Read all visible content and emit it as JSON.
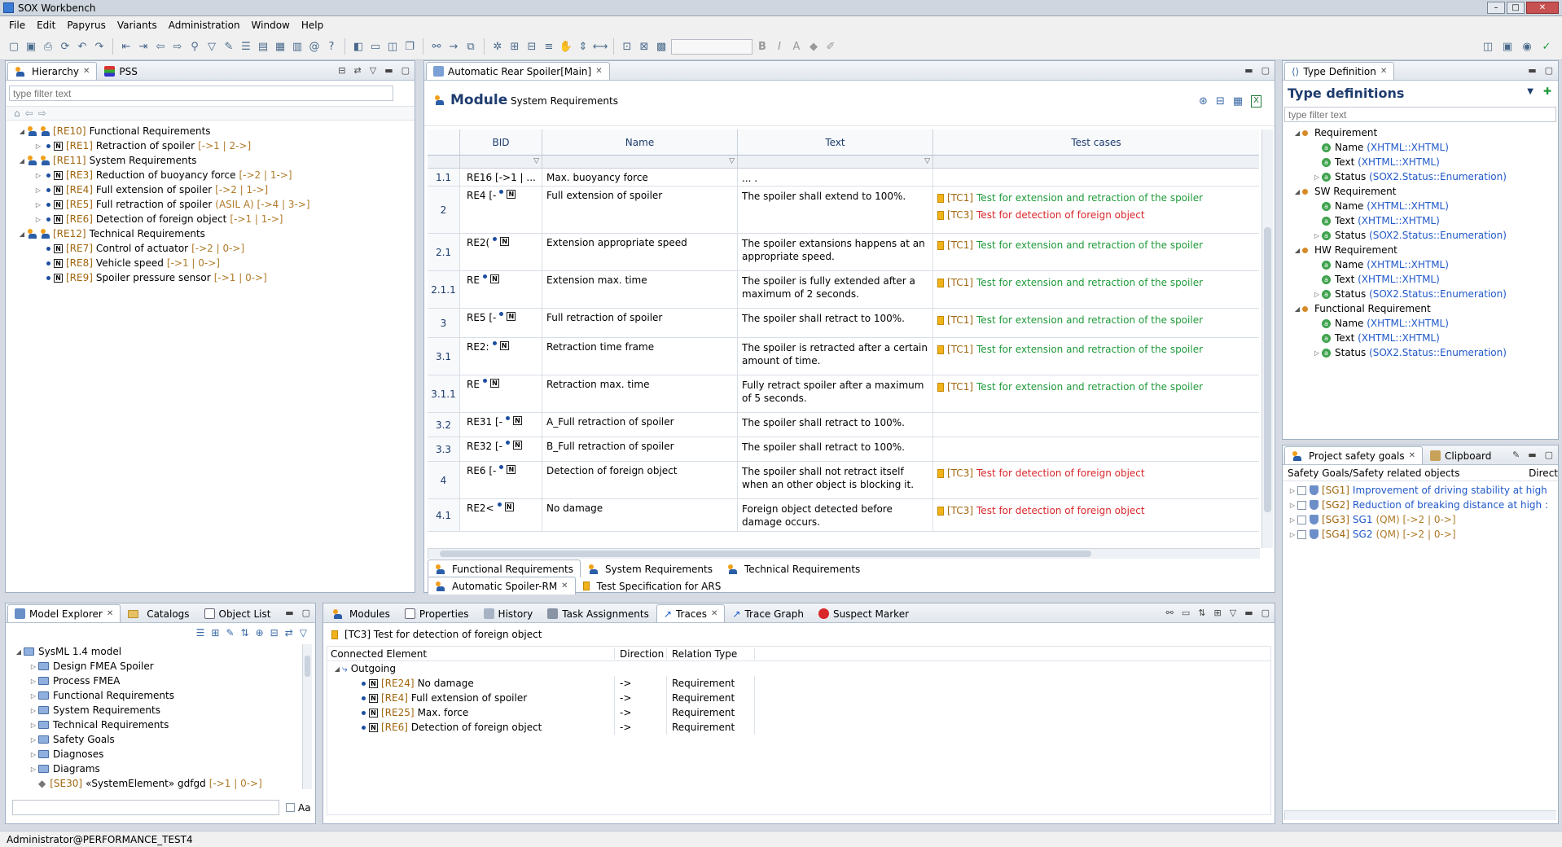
{
  "window": {
    "title": "SOX Workbench"
  },
  "menu": [
    "File",
    "Edit",
    "Papyrus",
    "Variants",
    "Administration",
    "Window",
    "Help"
  ],
  "hierarchy": {
    "tabs": [
      "Hierarchy",
      "PSS"
    ],
    "filter_placeholder": "type filter text",
    "rows": [
      {
        "level": 0,
        "id": "[RE10]",
        "label": "Functional Requirements",
        "meta": ""
      },
      {
        "level": 1,
        "id": "[RE1]",
        "label": "Retraction of spoiler",
        "meta": "[->1 | 2->]"
      },
      {
        "level": 0,
        "id": "[RE11]",
        "label": "System Requirements",
        "meta": ""
      },
      {
        "level": 1,
        "id": "[RE3]",
        "label": "Reduction of buoyancy force",
        "meta": "[->2 | 1->]"
      },
      {
        "level": 1,
        "id": "[RE4]",
        "label": "Full extension of spoiler",
        "meta": "[->2 | 1->]"
      },
      {
        "level": 1,
        "id": "[RE5]",
        "label": "Full retraction of spoiler",
        "meta": "(ASIL A) [->4 | 3->]"
      },
      {
        "level": 1,
        "id": "[RE6]",
        "label": "Detection of foreign object",
        "meta": "[->1 | 1->]"
      },
      {
        "level": 0,
        "id": "[RE12]",
        "label": "Technical Requirements",
        "meta": ""
      },
      {
        "level": 1,
        "id": "[RE7]",
        "label": "Control of actuator",
        "meta": "[->2 | 0->]"
      },
      {
        "level": 1,
        "id": "[RE8]",
        "label": "Vehicle speed",
        "meta": "[->1 | 0->]"
      },
      {
        "level": 1,
        "id": "[RE9]",
        "label": "Spoiler pressure sensor",
        "meta": "[->1 | 0->]"
      }
    ]
  },
  "editor": {
    "tab": "Automatic Rear Spoiler[Main]",
    "module_label": "Module",
    "module_name": "System Requirements",
    "columns": [
      "BID",
      "Name",
      "Text",
      "Test cases"
    ],
    "rows": [
      {
        "num": "1.1",
        "bid": "RE16 [->1 | ...",
        "name": "Max. buoyancy force",
        "text": "... .",
        "tcs": []
      },
      {
        "num": "2",
        "bid": "RE4 [-",
        "name": "Full extension of spoiler",
        "text": "The spoiler shall extend to 100%.",
        "tcs": [
          {
            "id": "[TC1]",
            "label": "Test for extension and retraction of the spoiler",
            "color": "green"
          },
          {
            "id": "[TC3]",
            "label": "Test for detection of foreign object",
            "color": "red"
          }
        ]
      },
      {
        "num": "2.1",
        "bid": "RE2(",
        "name": "Extension appropriate speed",
        "text": "The spoiler extansions happens at an appropriate speed.",
        "tcs": [
          {
            "id": "[TC1]",
            "label": "Test for extension and retraction of the spoiler",
            "color": "green"
          }
        ]
      },
      {
        "num": "2.1.1",
        "bid": "RE",
        "name": "Extension max. time",
        "text": "The spoiler is fully extended after a maximum of 2 seconds.",
        "tcs": [
          {
            "id": "[TC1]",
            "label": "Test for extension and retraction of the spoiler",
            "color": "green"
          }
        ]
      },
      {
        "num": "3",
        "bid": "RE5 [-",
        "name": "Full retraction of spoiler",
        "text": "The spoiler shall retract to 100%.",
        "tcs": [
          {
            "id": "[TC1]",
            "label": "Test for extension and retraction of the spoiler",
            "color": "green"
          }
        ]
      },
      {
        "num": "3.1",
        "bid": "RE2:",
        "name": "Retraction time frame",
        "text": "The spoiler is retracted after a certain amount of time.",
        "tcs": [
          {
            "id": "[TC1]",
            "label": "Test for extension and retraction of the spoiler",
            "color": "green"
          }
        ]
      },
      {
        "num": "3.1.1",
        "bid": "RE",
        "name": "Retraction max. time",
        "text": "Fully retract spoiler after a maximum of 5 seconds.",
        "tcs": [
          {
            "id": "[TC1]",
            "label": "Test for extension and retraction of the spoiler",
            "color": "green"
          }
        ]
      },
      {
        "num": "3.2",
        "bid": "RE31 [-",
        "name": "A_Full retraction of spoiler",
        "text": "The spoiler shall retract to 100%.",
        "tcs": []
      },
      {
        "num": "3.3",
        "bid": "RE32 [-",
        "name": "B_Full retraction of spoiler",
        "text": "The spoiler shall retract to 100%.",
        "tcs": []
      },
      {
        "num": "4",
        "bid": "RE6 [-",
        "name": "Detection of foreign object",
        "text": "The spoiler shall not retract itself when an other object is blocking it.",
        "tcs": [
          {
            "id": "[TC3]",
            "label": "Test for detection of foreign object",
            "color": "red"
          }
        ]
      },
      {
        "num": "4.1",
        "bid": "RE2<",
        "name": "No damage",
        "text": "Foreign object detected before damage occurs.",
        "tcs": [
          {
            "id": "[TC3]",
            "label": "Test for detection of foreign object",
            "color": "red"
          }
        ]
      }
    ],
    "bottom_tabs_row1": [
      "Functional Requirements",
      "System Requirements",
      "Technical Requirements"
    ],
    "bottom_tabs_row2": [
      "Automatic Spoiler-RM",
      "Test Specification for ARS"
    ]
  },
  "typedef": {
    "tab": "Type Definition",
    "title": "Type definitions",
    "filter_placeholder": "type filter text",
    "groups": [
      {
        "name": "Requirement",
        "attrs": [
          {
            "n": "Name",
            "t": "(XHTML::XHTML)"
          },
          {
            "n": "Text",
            "t": "(XHTML::XHTML)"
          },
          {
            "n": "Status",
            "t": "(SOX2.Status::Enumeration)"
          }
        ]
      },
      {
        "name": "SW Requirement",
        "attrs": [
          {
            "n": "Name",
            "t": "(XHTML::XHTML)"
          },
          {
            "n": "Text",
            "t": "(XHTML::XHTML)"
          },
          {
            "n": "Status",
            "t": "(SOX2.Status::Enumeration)"
          }
        ]
      },
      {
        "name": "HW Requirement",
        "attrs": [
          {
            "n": "Name",
            "t": "(XHTML::XHTML)"
          },
          {
            "n": "Text",
            "t": "(XHTML::XHTML)"
          },
          {
            "n": "Status",
            "t": "(SOX2.Status::Enumeration)"
          }
        ]
      },
      {
        "name": "Functional Requirement",
        "attrs": [
          {
            "n": "Name",
            "t": "(XHTML::XHTML)"
          },
          {
            "n": "Text",
            "t": "(XHTML::XHTML)"
          },
          {
            "n": "Status",
            "t": "(SOX2.Status::Enumeration)"
          }
        ]
      }
    ]
  },
  "safety": {
    "tabs": [
      "Project safety goals",
      "Clipboard"
    ],
    "col1": "Safety Goals/Safety related objects",
    "col2": "Direct",
    "rows": [
      {
        "id": "[SG1]",
        "label": "Improvement of driving stability at high",
        "meta": "",
        "blue": true
      },
      {
        "id": "[SG2]",
        "label": "Reduction of breaking distance at high :",
        "meta": "",
        "blue": true
      },
      {
        "id": "[SG3]",
        "label": "SG1",
        "meta": "(QM) [->2 | 0->]",
        "blue": false
      },
      {
        "id": "[SG4]",
        "label": "SG2",
        "meta": "(QM) [->2 | 0->]",
        "blue": false
      }
    ]
  },
  "model": {
    "tabs": [
      "Model Explorer",
      "Catalogs",
      "Object List"
    ],
    "root": "SysML 1.4 model",
    "items": [
      "Design FMEA Spoiler",
      "Process FMEA",
      "Functional Requirements",
      "System Requirements",
      "Technical Requirements",
      "Safety Goals",
      "Diagnoses",
      "Diagrams"
    ],
    "element": {
      "id": "[SE30]",
      "label": "«SystemElement» gdfgd",
      "meta": "[->1 | 0->]"
    },
    "case_label": "Aa"
  },
  "traces": {
    "tabs": [
      "Modules",
      "Properties",
      "History",
      "Task Assignments",
      "Traces",
      "Trace Graph",
      "Suspect Marker"
    ],
    "header": "[TC3] Test for detection of foreign object",
    "columns": [
      "Connected Element",
      "Direction",
      "Relation Type"
    ],
    "group": "Outgoing",
    "rows": [
      {
        "id": "[RE24]",
        "label": "No damage",
        "dir": "->",
        "type": "Requirement"
      },
      {
        "id": "[RE4]",
        "label": "Full extension of spoiler",
        "dir": "->",
        "type": "Requirement"
      },
      {
        "id": "[RE25]",
        "label": "Max. force",
        "dir": "->",
        "type": "Requirement"
      },
      {
        "id": "[RE6]",
        "label": "Detection of foreign object",
        "dir": "->",
        "type": "Requirement"
      }
    ]
  },
  "status": {
    "user": "Administrator@PERFORMANCE_TEST4"
  },
  "colors": {
    "accent": "#1e3c6e",
    "green": "#1f9a3a",
    "red": "#d9262a",
    "meta": "#b07a28"
  }
}
